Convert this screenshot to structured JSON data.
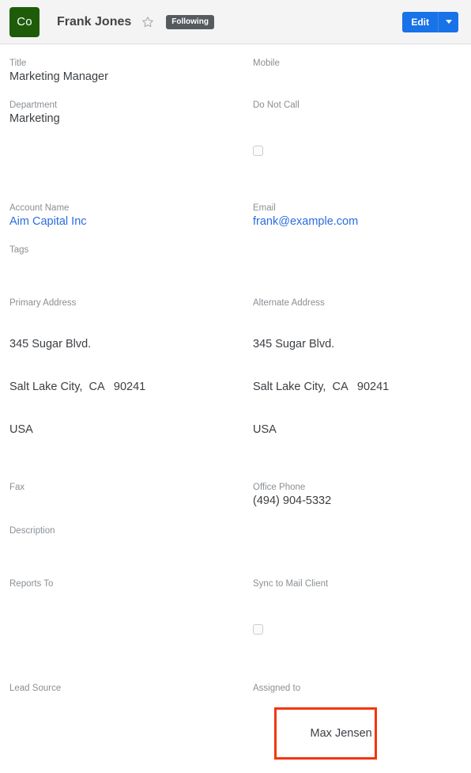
{
  "header": {
    "avatar_initials": "Co",
    "record_name": "Frank Jones",
    "favorite_icon": "star-outline-icon",
    "following_label": "Following",
    "edit_label": "Edit",
    "dropdown_icon": "chevron-down-icon",
    "accent_color": "#1872e8",
    "avatar_color": "#1e5c0a",
    "badge_color": "#555a5f"
  },
  "fields": {
    "title": {
      "label": "Title",
      "value": "Marketing Manager"
    },
    "mobile": {
      "label": "Mobile",
      "value": ""
    },
    "department": {
      "label": "Department",
      "value": "Marketing"
    },
    "do_not_call": {
      "label": "Do Not Call",
      "checked": false
    },
    "account_name": {
      "label": "Account Name",
      "value": "Aim Capital Inc"
    },
    "email": {
      "label": "Email",
      "value": "frank@example.com"
    },
    "tags": {
      "label": "Tags",
      "value": ""
    },
    "primary_address": {
      "label": "Primary Address",
      "line1": "345 Sugar Blvd.",
      "line2": "Salt Lake City,  CA   90241",
      "line3": "USA"
    },
    "alternate_address": {
      "label": "Alternate Address",
      "line1": "345 Sugar Blvd.",
      "line2": "Salt Lake City,  CA   90241",
      "line3": "USA"
    },
    "fax": {
      "label": "Fax",
      "value": ""
    },
    "office_phone": {
      "label": "Office Phone",
      "value": "(494) 904-5332"
    },
    "description": {
      "label": "Description",
      "value": ""
    },
    "reports_to": {
      "label": "Reports To",
      "value": ""
    },
    "sync_to_mail_client": {
      "label": "Sync to Mail Client",
      "checked": false
    },
    "lead_source": {
      "label": "Lead Source",
      "value": ""
    },
    "assigned_to": {
      "label": "Assigned to",
      "value": "Max Jensen"
    }
  },
  "annotation": {
    "target": "assigned-to-value",
    "color": "#f4350f"
  },
  "link_color": "#2a6ce0"
}
